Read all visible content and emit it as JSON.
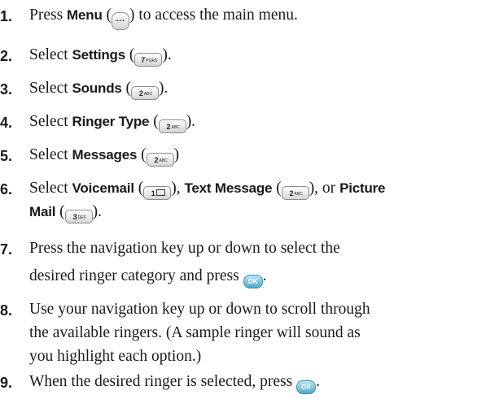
{
  "steps": [
    {
      "n": "1.",
      "parts": {
        "a": "Press ",
        "b": "Menu",
        "c": " (",
        "d": ") to access the main menu."
      },
      "keys": {
        "menu": "···"
      }
    },
    {
      "n": "2.",
      "parts": {
        "a": "Select ",
        "b": "Settings",
        "c": " (",
        "d": ")."
      },
      "keys": {
        "k": "7",
        "sub": "PQRS"
      }
    },
    {
      "n": "3.",
      "parts": {
        "a": "Select ",
        "b": "Sounds",
        "c": " (",
        "d": ")."
      },
      "keys": {
        "k": "2",
        "sub": "ABC"
      }
    },
    {
      "n": "4.",
      "parts": {
        "a": "Select ",
        "b": "Ringer Type",
        "c": " (",
        "d": ")."
      },
      "keys": {
        "k": "2",
        "sub": "ABC"
      }
    },
    {
      "n": "5.",
      "parts": {
        "a": "Select ",
        "b": "Messages",
        "c": " (",
        "d": ")"
      },
      "keys": {
        "k": "2",
        "sub": "ABC"
      }
    },
    {
      "n": "6.",
      "line1": {
        "a": "Select ",
        "b": "Voicemail",
        "c": " (",
        "d": "), ",
        "e": "Text Message",
        "f": " (",
        "g": "), or ",
        "h": "Picture"
      },
      "line2": {
        "b": "Mail",
        "c": " (",
        "d": ")."
      },
      "keys": {
        "k1": "1",
        "k2": "2",
        "sub2": "ABC",
        "k3": "3",
        "sub3": "DEF"
      }
    },
    {
      "n": "7.",
      "line1": "Press the navigation key up or down to select the",
      "line2": "desired ringer category and press ",
      "line2_end": ".",
      "ok": "OK"
    },
    {
      "n": "8.",
      "line1": "Use your navigation key up or down to scroll through",
      "line2": "the available ringers. (A sample ringer will sound as",
      "line3": "you highlight each option.)"
    },
    {
      "n": "9.",
      "line1": "When the desired ringer is selected, press ",
      "line1_end": ".",
      "ok": "OK"
    }
  ]
}
